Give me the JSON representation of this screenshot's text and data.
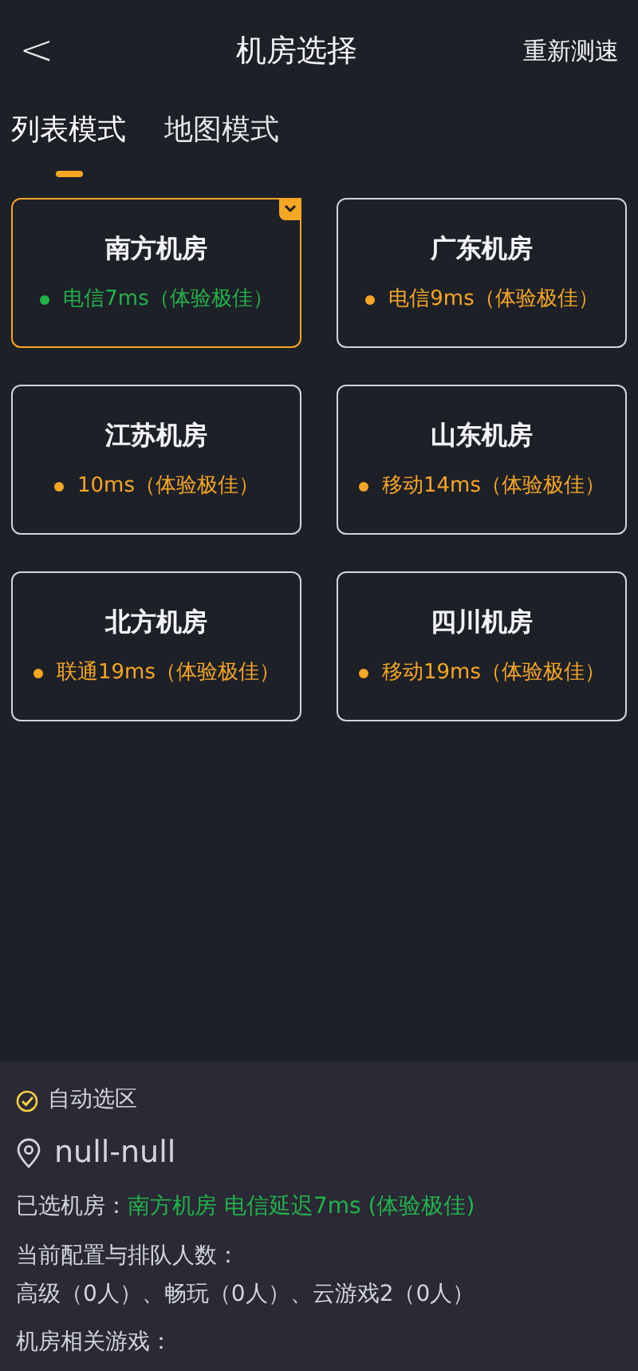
{
  "header": {
    "back": "<",
    "title": "机房选择",
    "action": "重新测速"
  },
  "tabs": [
    {
      "label": "列表模式",
      "selected": true
    },
    {
      "label": "地图模式",
      "selected": false
    }
  ],
  "rooms": [
    {
      "name": "南方机房",
      "latency": "电信7ms（体验极佳）",
      "color": "#22b14c",
      "selected": true
    },
    {
      "name": "广东机房",
      "latency": "电信9ms（体验极佳）",
      "color": "#f5a623",
      "selected": false
    },
    {
      "name": "江苏机房",
      "latency": "10ms（体验极佳）",
      "color": "#f5a623",
      "selected": false
    },
    {
      "name": "山东机房",
      "latency": "移动14ms（体验极佳）",
      "color": "#f5a623",
      "selected": false
    },
    {
      "name": "北方机房",
      "latency": "联通19ms（体验极佳）",
      "color": "#f5a623",
      "selected": false
    },
    {
      "name": "四川机房",
      "latency": "移动19ms（体验极佳）",
      "color": "#f5a623",
      "selected": false
    }
  ],
  "panel": {
    "auto_select": {
      "label": "自动选区",
      "checked": true
    },
    "location": "null-null",
    "selected_label": "已选机房：",
    "selected_value": "南方机房 电信延迟7ms (体验极佳)",
    "queue_label": "当前配置与排队人数：",
    "queue_value": "高级（0人）、畅玩（0人）、云游戏2（0人）",
    "games_label": "机房相关游戏："
  }
}
